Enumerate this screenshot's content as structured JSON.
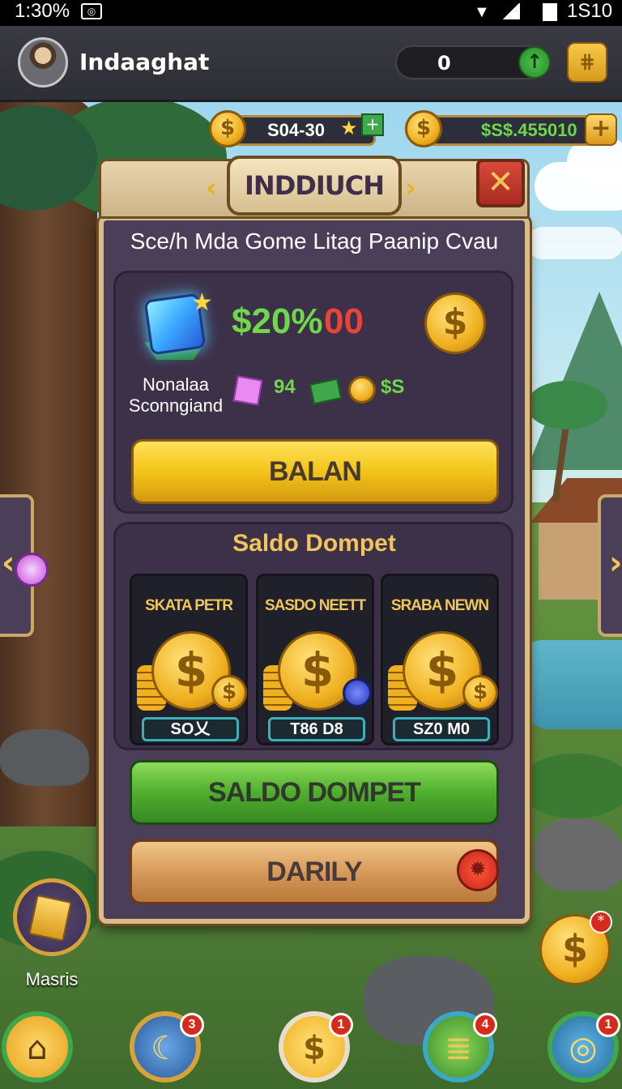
{
  "status_bar": {
    "time": "1:30%",
    "right_value": "1S10"
  },
  "header": {
    "player_name": "Indaaghat",
    "pill_value": "0",
    "up_icon": "arrow-up-icon",
    "menu_icon": "grid-menu-icon"
  },
  "currencies": {
    "coins_value": "S04-30",
    "cash_value": "$S$.455010"
  },
  "panel": {
    "title": "INDDIUCH",
    "subtitle": "Sce/h Mda Gome Litag Paanip Cvau",
    "close_icon": "close-x-icon",
    "offer": {
      "name_line1": "Nonalaa",
      "name_line2": "Sconngiand",
      "percent": "$20%",
      "red_value": "00",
      "reward_gem_amount": "94",
      "reward_coins_amount": "$S"
    },
    "balance_button": "BALAN",
    "section_title": "Saldo Dompet",
    "cards": [
      {
        "title": "SKATA PETR",
        "price": "SO乂"
      },
      {
        "title": "SASDO NEETT",
        "price": "T86 D8"
      },
      {
        "title": "SRABA NEWN",
        "price": "SZ0 M0"
      }
    ],
    "saldo_button": "SALDO DOMPET",
    "daily_button": "DARILY"
  },
  "side": {
    "masris_label": "Masris",
    "float_coin_badge": "*"
  },
  "bottom_nav": [
    {
      "icon": "home-icon",
      "badge": ""
    },
    {
      "icon": "trophy-icon",
      "badge": "3"
    },
    {
      "icon": "coin-icon",
      "badge": "1"
    },
    {
      "icon": "cash-stack-icon",
      "badge": "4"
    },
    {
      "icon": "globe-icon",
      "badge": "1"
    }
  ],
  "colors": {
    "panel_bg": "#4a3e58",
    "frame_gold": "#d9bc86",
    "accent_green": "#6ed84a",
    "accent_red": "#e8443a",
    "gold_text": "#f2c55a"
  }
}
